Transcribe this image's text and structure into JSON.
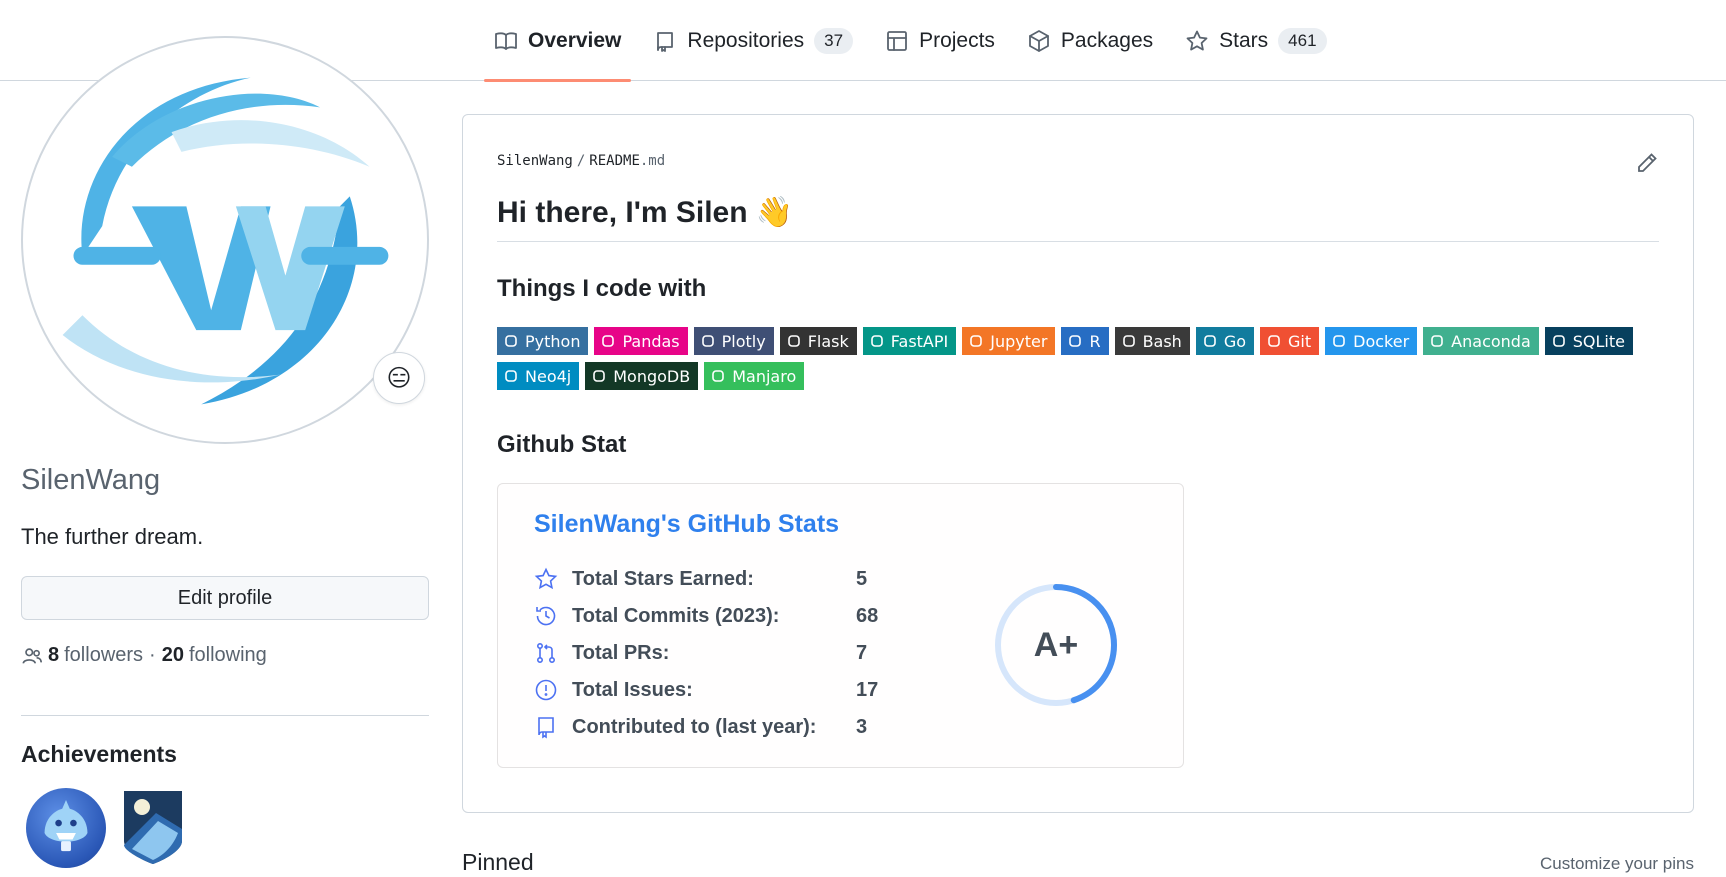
{
  "nav": {
    "tabs": [
      {
        "label": "Overview",
        "count": null
      },
      {
        "label": "Repositories",
        "count": "37"
      },
      {
        "label": "Projects",
        "count": null
      },
      {
        "label": "Packages",
        "count": null
      },
      {
        "label": "Stars",
        "count": "461"
      }
    ]
  },
  "profile": {
    "status_emoji": "😑",
    "username": "SilenWang",
    "bio": "The further dream.",
    "edit_label": "Edit profile",
    "followers_count": "8",
    "followers_label": "followers",
    "separator": "·",
    "following_count": "20",
    "following_label": "following",
    "achievements_title": "Achievements"
  },
  "readme": {
    "owner": "SilenWang",
    "sep": "/",
    "file_base": "README",
    "file_ext": ".md",
    "heading": "Hi there, I'm Silen 👋",
    "section1": "Things I code with",
    "section2": "Github Stat",
    "badges": [
      {
        "label": "Python",
        "color": "#3670a0"
      },
      {
        "label": "Pandas",
        "color": "#e70488"
      },
      {
        "label": "Plotly",
        "color": "#3f4f75"
      },
      {
        "label": "Flask",
        "color": "#333333"
      },
      {
        "label": "FastAPI",
        "color": "#049688"
      },
      {
        "label": "Jupyter",
        "color": "#f37626"
      },
      {
        "label": "R",
        "color": "#276dc3"
      },
      {
        "label": "Bash",
        "color": "#3a3a3a"
      },
      {
        "label": "Go",
        "color": "#117c9e"
      },
      {
        "label": "Git",
        "color": "#f05033"
      },
      {
        "label": "Docker",
        "color": "#2496ed"
      },
      {
        "label": "Anaconda",
        "color": "#40b08f"
      },
      {
        "label": "SQLite",
        "color": "#07405e"
      },
      {
        "label": "Neo4j",
        "color": "#008cc1"
      },
      {
        "label": "MongoDB",
        "color": "#133826"
      },
      {
        "label": "Manjaro",
        "color": "#35bf5c"
      }
    ]
  },
  "stats_card": {
    "title": "SilenWang's GitHub Stats",
    "rows": [
      {
        "icon": "star-icon",
        "label": "Total Stars Earned:",
        "value": "5"
      },
      {
        "icon": "history-icon",
        "label": "Total Commits (2023):",
        "value": "68"
      },
      {
        "icon": "pull-request-icon",
        "label": "Total PRs:",
        "value": "7"
      },
      {
        "icon": "issue-icon",
        "label": "Total Issues:",
        "value": "17"
      },
      {
        "icon": "repo-icon",
        "label": "Contributed to (last year):",
        "value": "3"
      }
    ],
    "rank": "A+",
    "rank_progress": 0.45,
    "accent": "#2f80ed"
  },
  "pinned": {
    "title": "Pinned",
    "customize_label": "Customize your pins"
  }
}
